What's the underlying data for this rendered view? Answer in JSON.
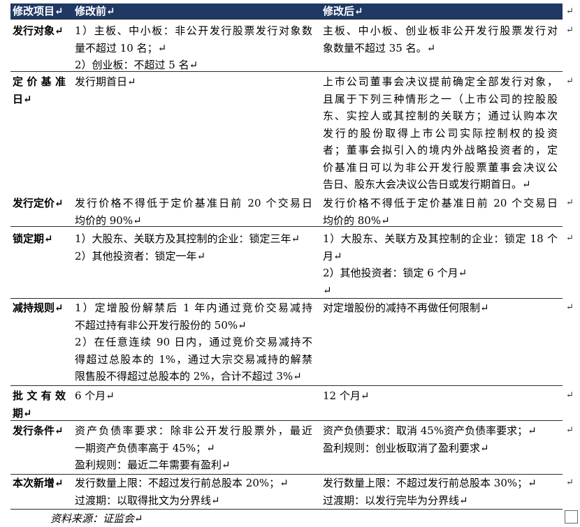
{
  "header": {
    "item": "修改项目↵",
    "before": "修改前↵",
    "after": "修改后↵"
  },
  "row_end_mark": "↵",
  "rows": [
    {
      "item": [
        "发行对象↵"
      ],
      "before": [
        [
          "1）主板、中小板：非公开发行股票发行对象数",
          "量不超过 10 名；↵"
        ],
        [
          "2）创业板：不超过 5 名↵"
        ]
      ],
      "after": [
        [
          "主板、中小板、创业板非公开发行股票发行对",
          "象数量不超过 35 名。↵"
        ]
      ]
    },
    {
      "item": [
        "定价基准",
        "日↵"
      ],
      "before": [
        [
          "发行期首日↵"
        ]
      ],
      "after": [
        [
          "上市公司董事会决议提前确定全部发行对象，",
          "且属于下列三种情形之一（上市公司的控股股",
          "东、实控人或其控制的关联方；通过认购本次",
          "发行的股份取得上市公司实际控制权的投资",
          "者；董事会拟引入的境内外战略投资者的，定",
          "价基准日可以为非公开发行股票董事会决议公",
          "告日、股东大会决议公告日或发行期首日。↵"
        ]
      ]
    },
    {
      "item": [
        "发行定价↵"
      ],
      "before": [
        [
          "发行价格不得低于定价基准日前 20 个交易日",
          "均价的 90%↵"
        ]
      ],
      "after": [
        [
          "发行价格不得低于定价基准日前 20 个交易日",
          "均价的 80%↵"
        ]
      ]
    },
    {
      "item": [
        "锁定期↵"
      ],
      "before": [
        [
          "1）大股东、关联方及其控制的企业：锁定三年↵"
        ],
        [
          "2）其他投资者：锁定一年↵"
        ]
      ],
      "after": [
        [
          "1）大股东、关联方及其控制的企业：锁定 18 个",
          "月↵"
        ],
        [
          "2）其他投资者：锁定 6 个月↵"
        ],
        [
          "↵"
        ]
      ]
    },
    {
      "item": [
        "减持规则↵"
      ],
      "before": [
        [
          "1）定增股份解禁后 1 年内通过竞价交易减持",
          "不超过持有非公开发行股份的 50%↵"
        ],
        [
          "2）在任意连续 90 日内，通过竞价交易减持不",
          "得超过总股本的 1%，通过大宗交易减持的解禁",
          "限售股不得超过总股本的 2%，合计不超过 3%↵"
        ]
      ],
      "after": [
        [
          "对定增股份的减持不再做任何限制↵"
        ]
      ]
    },
    {
      "item": [
        "批文有效",
        "期↵"
      ],
      "before": [
        [
          "6 个月↵"
        ]
      ],
      "after": [
        [
          "12 个月↵"
        ]
      ]
    },
    {
      "item": [
        "发行条件↵"
      ],
      "before": [
        [
          "资产负债率要求：除非公开发行股票外，最近",
          "一期资产负债率高于 45%；↵"
        ],
        [
          "盈利规则：最近二年需要有盈利↵"
        ]
      ],
      "after": [
        [
          "资产负债要求：取消 45%资产负债率要求；↵"
        ],
        [
          "盈利规则：创业板取消了盈利要求↵"
        ]
      ]
    },
    {
      "item": [
        "本次新增↵"
      ],
      "before": [
        [
          "发行数量上限：不超过发行前总股本 20%；↵"
        ],
        [
          "过渡期：以取得批文为分界线↵"
        ]
      ],
      "after": [
        [
          "发行数量上限：不超过发行前总股本 30%；↵"
        ],
        [
          "过渡期：以发行完毕为分界线↵"
        ]
      ]
    }
  ],
  "source": "资料来源：证监会↵",
  "colors": {
    "header_bg": "#1f3864",
    "header_text": "#ffffff",
    "text": "#000000",
    "rule": "#2b2b2b"
  }
}
